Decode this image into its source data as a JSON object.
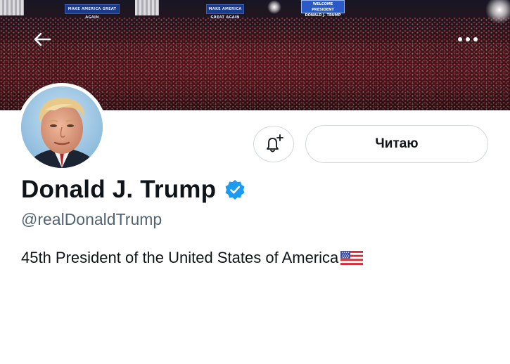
{
  "banner": {
    "signs": [
      "MAKE AMERICA GREAT AGAIN",
      "MAKE AMERICA GREAT AGAIN"
    ],
    "stage_sign_lines": [
      "WELCOME",
      "PRESIDENT",
      "DONALD J. TRUMP"
    ]
  },
  "nav": {
    "back_icon": "arrow-left-icon",
    "more_icon": "more-horizontal-icon"
  },
  "profile": {
    "avatar": "profile-photo",
    "display_name": "Donald J. Trump",
    "verified_icon": "verified-badge-icon",
    "handle": "@realDonaldTrump",
    "bio": "45th President of the United States of America",
    "bio_emoji": "us-flag-icon"
  },
  "actions": {
    "notify_icon": "bell-plus-icon",
    "follow_label": "Читаю"
  },
  "colors": {
    "verified": "#1d9bf0",
    "handle": "#536471",
    "border": "#cfd9de",
    "text": "#0f1419"
  }
}
